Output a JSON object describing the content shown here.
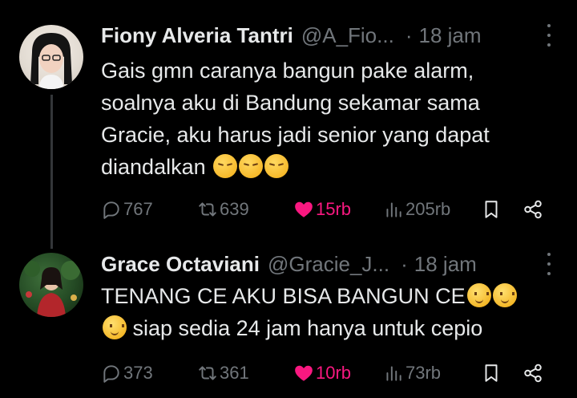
{
  "tweets": [
    {
      "display_name": "Fiony Alveria Tantri",
      "handle": "@A_Fio...",
      "separator": "·",
      "time": "18 jam",
      "text": "Gais gmn caranya bangun pake alarm,\nsoalnya aku di Bandung sekamar sama\nGracie, aku harus jadi senior yang dapat\ndiandalkan ",
      "emoji": [
        "pensive-face",
        "pensive-face",
        "pensive-face"
      ],
      "replies": "767",
      "reposts": "639",
      "likes": "15rb",
      "views": "205rb",
      "liked": true
    },
    {
      "display_name": "Grace Octaviani",
      "handle": "@Gracie_J...",
      "separator": "·",
      "time": "18 jam",
      "text_line1": "TENANG CE AKU BISA BANGUN CE",
      "text_line2": " siap sedia 24 jam hanya untuk cepio",
      "emoji": [
        "saluting-face",
        "saluting-face",
        "saluting-face"
      ],
      "replies": "373",
      "reposts": "361",
      "likes": "10rb",
      "views": "73rb",
      "liked": true
    }
  ],
  "colors": {
    "background": "#000000",
    "text": "#e7e9ea",
    "muted": "#71767b",
    "like": "#f91880",
    "thread_line": "#333639"
  }
}
